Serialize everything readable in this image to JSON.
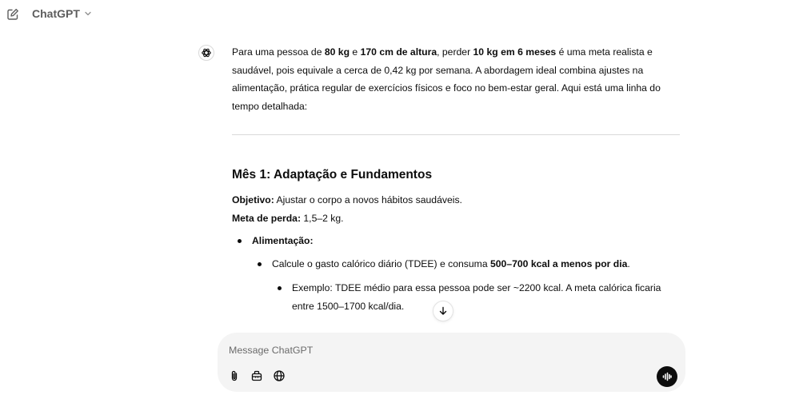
{
  "header": {
    "model_name": "ChatGPT"
  },
  "icons": {
    "new_chat": "edit-square-icon",
    "model_dropdown": "chevron-down-icon",
    "assistant": "openai-logo-icon",
    "scroll_down": "arrow-down-icon",
    "attach": "paperclip-icon",
    "tools": "toolbox-icon",
    "web_search": "globe-icon",
    "voice": "voice-waveform-icon"
  },
  "message": {
    "intro": {
      "t1": "Para uma pessoa de ",
      "b1": "80 kg",
      "t2": " e ",
      "b2": "170 cm de altura",
      "t3": ", perder ",
      "b3": "10 kg em 6 meses",
      "t4": " é uma meta realista e saudável, pois equivale a cerca de 0,42 kg por semana. A abordagem ideal combina ajustes na alimentação, prática regular de exercícios físicos e foco no bem-estar geral. Aqui está uma linha do tempo detalhada:"
    },
    "section": {
      "heading": "Mês 1: Adaptação e Fundamentos",
      "objective_label": "Objetivo:",
      "objective_value": " Ajustar o corpo a novos hábitos saudáveis.",
      "goal_label": "Meta de perda:",
      "goal_value": " 1,5–2 kg.",
      "bullet_food": "Alimentação:",
      "sub_bullet": {
        "t1": "Calcule o gasto calórico diário (TDEE) e consuma ",
        "b1": "500–700 kcal a menos por dia",
        "t2": "."
      },
      "example": "Exemplo: TDEE médio para essa pessoa pode ser ~2200 kcal. A meta calórica ficaria entre 1500–1700 kcal/dia."
    }
  },
  "composer": {
    "placeholder": "Message ChatGPT",
    "value": ""
  },
  "colors": {
    "text": "#0d0d0d",
    "muted": "#5d5d5d",
    "composer_bg": "#f4f4f4",
    "divider": "#d9d9d9",
    "voice_button": "#0d0d0d"
  }
}
